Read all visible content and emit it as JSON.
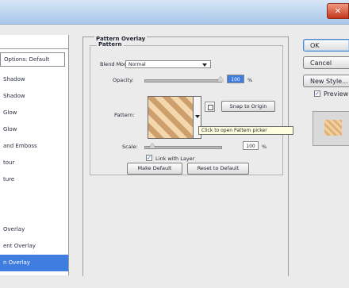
{
  "dialog": {
    "close_glyph": "✕"
  },
  "sidebar": {
    "items": [
      {
        "label": "Options: Default",
        "boxed": true
      },
      {
        "label": "Shadow"
      },
      {
        "label": "Shadow"
      },
      {
        "label": "Glow"
      },
      {
        "label": "Glow"
      },
      {
        "label": "and Emboss"
      },
      {
        "label": "tour"
      },
      {
        "label": "ture"
      },
      {
        "label": ""
      },
      {
        "label": ""
      },
      {
        "label": "Overlay"
      },
      {
        "label": "ent Overlay"
      },
      {
        "label": "n Overlay",
        "selected": true
      },
      {
        "label": ""
      }
    ]
  },
  "panel": {
    "title": "Pattern Overlay",
    "subtitle": "Pattern",
    "blend_mode_label": "Blend Mode:",
    "blend_mode_value": "Normal",
    "opacity_label": "Opacity:",
    "opacity_value": "100",
    "opacity_unit": "%",
    "opacity_fraction": 1.0,
    "pattern_label": "Pattern:",
    "snap_button": "Snap to Origin",
    "tooltip": "Click to open Pattern picker",
    "scale_label": "Scale:",
    "scale_value": "100",
    "scale_unit": "%",
    "scale_fraction": 0.1,
    "link_label": "Link with Layer",
    "link_checked": true,
    "make_default": "Make Default",
    "reset_default": "Reset to Default"
  },
  "right": {
    "ok": "OK",
    "cancel": "Cancel",
    "new_style": "New Style...",
    "preview_label": "Preview",
    "preview_checked": true
  },
  "colors": {
    "accent": "#3f7de0",
    "pattern_light": "#f4d7ad",
    "pattern_dark": "#cd9f6d"
  },
  "icons": [
    "close-icon",
    "dropdown-arrow-icon",
    "new-pattern-icon",
    "checkmark-icon"
  ]
}
